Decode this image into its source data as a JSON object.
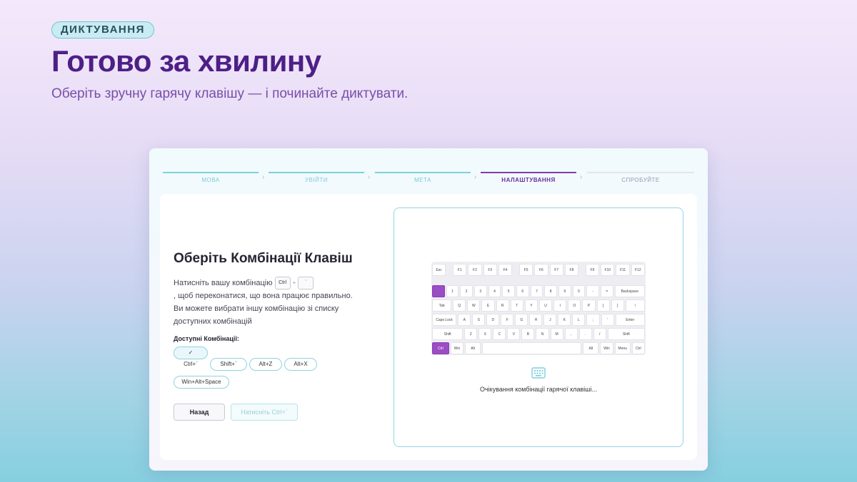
{
  "hero": {
    "badge": "ДИКТУВАННЯ",
    "title": "Готово за хвилину",
    "subtitle": "Оберіть зручну гарячу клавішу — і починайте диктувати."
  },
  "steps": [
    {
      "label": "МОВА",
      "state": "done"
    },
    {
      "label": "УВІЙТИ",
      "state": "done"
    },
    {
      "label": "МЕТА",
      "state": "done"
    },
    {
      "label": "НАЛАШТУВАННЯ",
      "state": "active"
    },
    {
      "label": "СПРОБУЙТЕ",
      "state": "future"
    }
  ],
  "setup": {
    "title": "Оберіть Комбінації Клавіш",
    "desc_part1": "Натисніть вашу комбінацію",
    "key1": "Ctrl",
    "key_plus": "+",
    "key2": "`",
    "desc_part2": ", щоб переконатися, що вона працює правильно. Ви можете вибрати іншу комбінацію зі списку доступних комбінацій",
    "available_label": "Доступні Комбінації:",
    "combos": [
      {
        "label": "Ctrl+`",
        "selected": true,
        "check": "✓"
      },
      {
        "label": "Shift+`",
        "selected": false
      },
      {
        "label": "Alt+Z",
        "selected": false
      },
      {
        "label": "Alt+X",
        "selected": false
      },
      {
        "label": "Win+Alt+Space",
        "selected": false
      }
    ],
    "back_label": "Назад",
    "next_label": "Натисніть Ctrl+`"
  },
  "keyboard": {
    "rows": [
      [
        "Esc",
        "",
        "F1",
        "F2",
        "F3",
        "F4",
        "",
        "F5",
        "F6",
        "F7",
        "F8",
        "",
        "F9",
        "F10",
        "F11",
        "F12"
      ],
      [
        "`",
        "1",
        "2",
        "3",
        "4",
        "5",
        "6",
        "7",
        "8",
        "9",
        "0",
        "-",
        "=",
        "Backspace"
      ],
      [
        "Tab",
        "Q",
        "W",
        "E",
        "R",
        "T",
        "Y",
        "U",
        "I",
        "O",
        "P",
        "[",
        "]",
        "\\"
      ],
      [
        "Caps Lock",
        "A",
        "S",
        "D",
        "F",
        "G",
        "H",
        "J",
        "K",
        "L",
        ";",
        "'",
        "Enter"
      ],
      [
        "Shift",
        "Z",
        "X",
        "C",
        "V",
        "B",
        "N",
        "M",
        ",",
        ".",
        "/",
        "Shift"
      ],
      [
        "Ctrl",
        "Win",
        "Alt",
        "",
        "Alt",
        "Win",
        "Menu",
        "Ctrl"
      ]
    ],
    "highlighted": [
      "`",
      "Ctrl"
    ],
    "icon": "keyboard-icon",
    "waiting_text": "Очікування комбінації гарячої клавіші..."
  },
  "colors": {
    "accent": "#9b4dc4",
    "title": "#4d1f86",
    "teal": "#7ed0dd"
  }
}
